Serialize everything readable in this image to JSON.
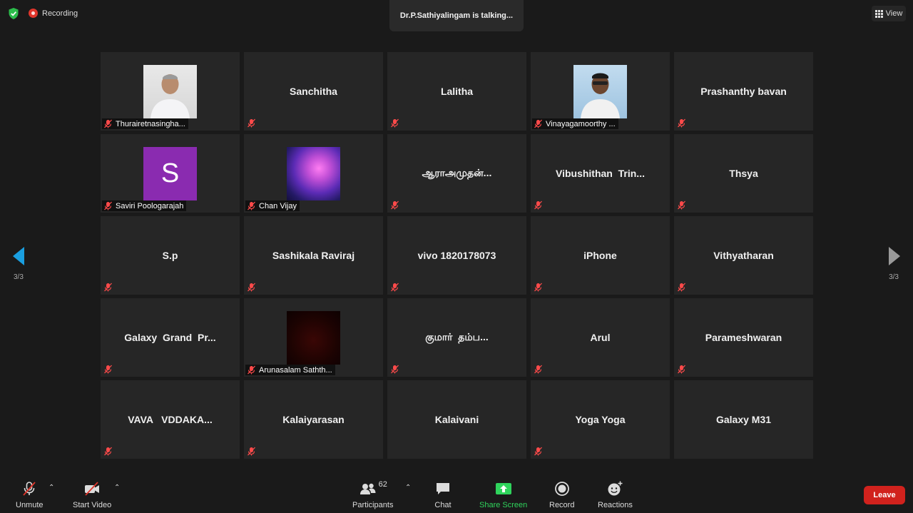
{
  "header": {
    "recording_label": "Recording",
    "talking_text": "Dr.P.Sathiyalingam is talking...",
    "view_label": "View"
  },
  "gallery": {
    "tiles": [
      {
        "name": "Thurairetnasingha...",
        "avatar": "photo1"
      },
      {
        "name": "Sanchitha",
        "avatar": ""
      },
      {
        "name": "Lalitha",
        "avatar": ""
      },
      {
        "name": "Vinayagamoorthy ...",
        "avatar": "photo2"
      },
      {
        "name": "Prashanthy bavan",
        "avatar": ""
      },
      {
        "name": "Saviri Poologarajah",
        "avatar": "letter",
        "letter": "S"
      },
      {
        "name": "Chan Vijay",
        "avatar": "galaxy"
      },
      {
        "name": "ஆராஅமுதன்...",
        "avatar": ""
      },
      {
        "name": "Vibushithan  Trin...",
        "avatar": ""
      },
      {
        "name": "Thsya",
        "avatar": ""
      },
      {
        "name": "S.p",
        "avatar": ""
      },
      {
        "name": "Sashikala Raviraj",
        "avatar": ""
      },
      {
        "name": "vivo 1820178073",
        "avatar": ""
      },
      {
        "name": "iPhone",
        "avatar": ""
      },
      {
        "name": "Vithyatharan",
        "avatar": ""
      },
      {
        "name": "Galaxy  Grand  Pr...",
        "avatar": ""
      },
      {
        "name": "Arunasalam Sathth...",
        "avatar": "dark"
      },
      {
        "name": "குமார்  தம்ப...",
        "avatar": ""
      },
      {
        "name": "Arul",
        "avatar": ""
      },
      {
        "name": "Parameshwaran",
        "avatar": ""
      },
      {
        "name": "VAVA   VDDAKA...",
        "avatar": ""
      },
      {
        "name": "Kalaiyarasan",
        "avatar": ""
      },
      {
        "name": "Kalaivani",
        "avatar": "",
        "muted": false
      },
      {
        "name": "Yoga Yoga",
        "avatar": ""
      },
      {
        "name": "Galaxy M31",
        "avatar": "",
        "muted": false
      }
    ]
  },
  "pagination": {
    "left_label": "3/3",
    "right_label": "3/3"
  },
  "toolbar": {
    "unmute_label": "Unmute",
    "start_video_label": "Start Video",
    "participants_label": "Participants",
    "participants_count": "62",
    "chat_label": "Chat",
    "share_screen_label": "Share Screen",
    "record_label": "Record",
    "reactions_label": "Reactions",
    "leave_label": "Leave"
  },
  "colors": {
    "accent_blue": "#1a9fe0",
    "share_green": "#2fd45c",
    "leave_red": "#d1221d",
    "recording_red": "#e0352b"
  }
}
